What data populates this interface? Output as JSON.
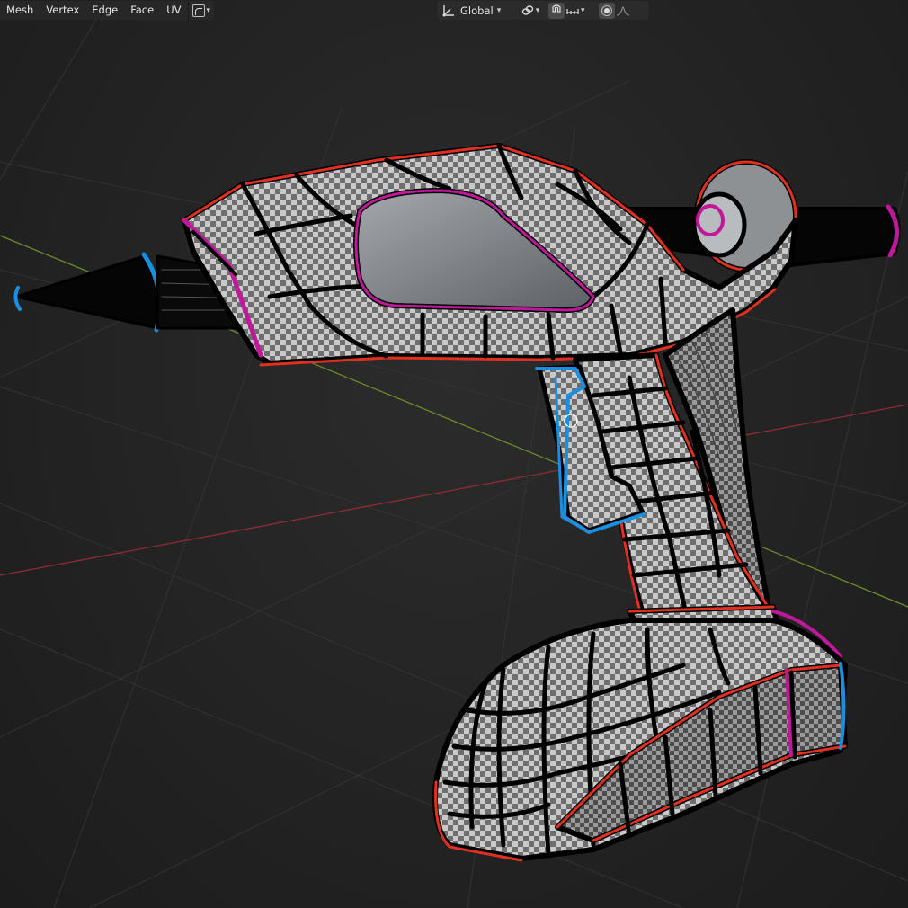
{
  "header": {
    "menus": [
      {
        "id": "mesh",
        "label": "Mesh"
      },
      {
        "id": "vertex",
        "label": "Vertex"
      },
      {
        "id": "edge",
        "label": "Edge"
      },
      {
        "id": "face",
        "label": "Face"
      },
      {
        "id": "uv",
        "label": "UV"
      }
    ],
    "select_mode_icon": "lasso-select-icon",
    "transform_orientation": "Global",
    "icons": {
      "orientation": "transform-orientation-icon",
      "pivot": "pivot-link-icon",
      "snap": "snap-magnet-icon",
      "snap_target": "snap-increment-icon",
      "proportional": "proportional-editing-icon",
      "falloff": "falloff-curve-icon"
    }
  },
  "viewport": {
    "background_color": "#232323",
    "grid_color": "#333333",
    "x_axis_color": "#8c2d35",
    "y_axis_color": "#6a8a2a",
    "wire_colors": {
      "edge": "#000000",
      "seam_red": "#e0301f",
      "seam_magenta": "#c0189a",
      "seam_blue": "#1a8fe0"
    },
    "object": "hot-glue-gun-mesh"
  }
}
